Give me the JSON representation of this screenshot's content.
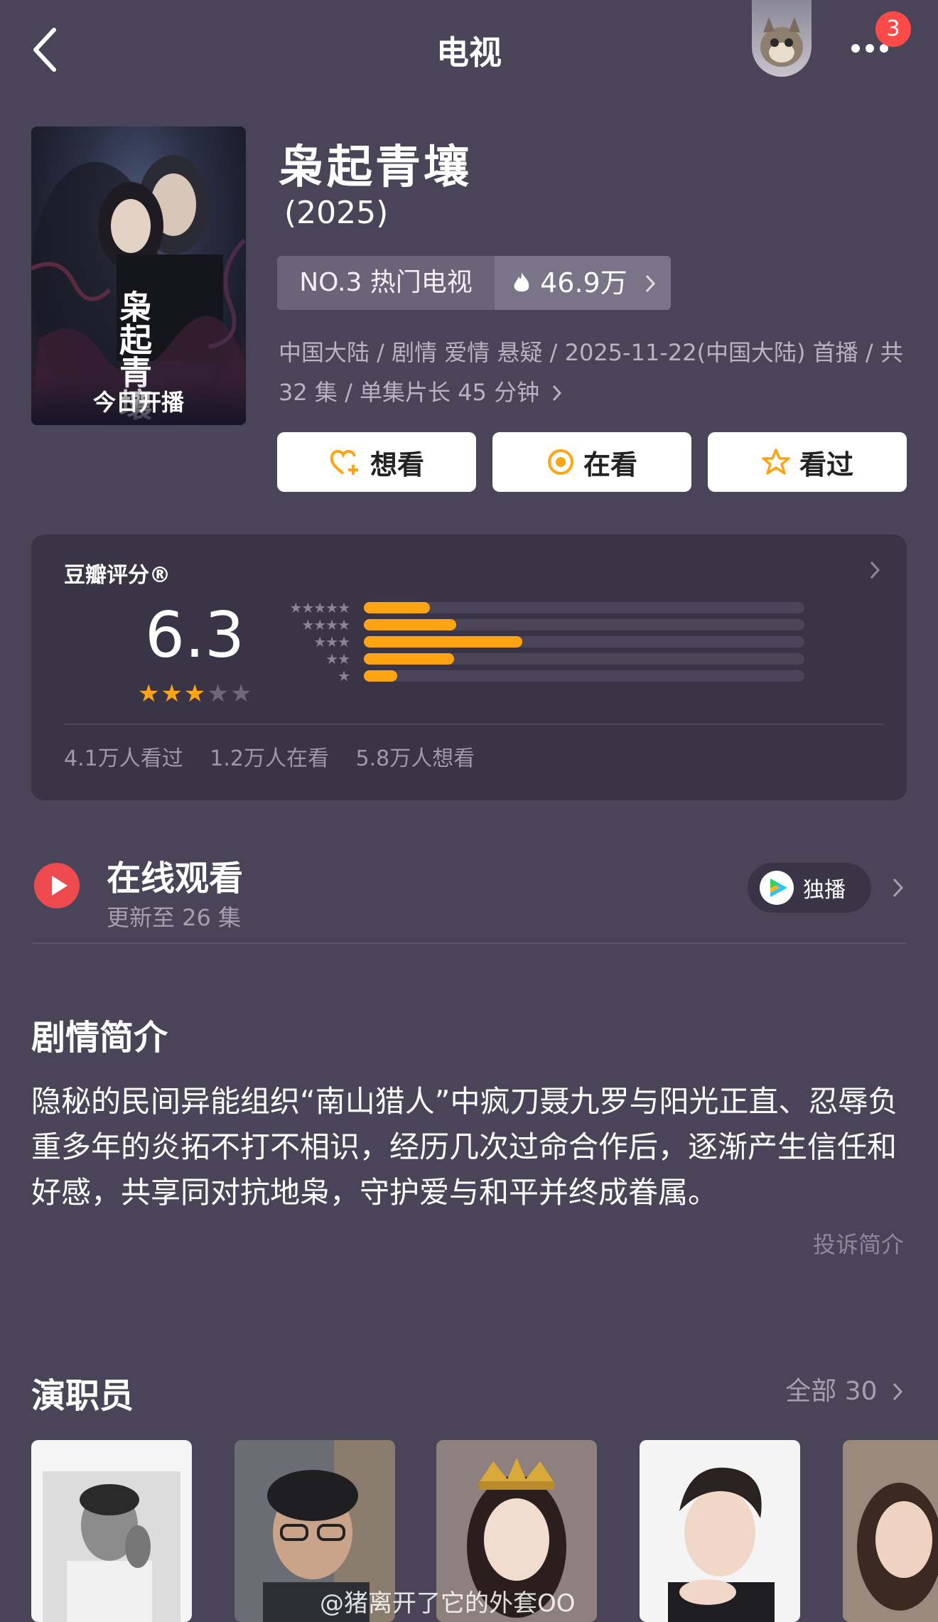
{
  "header": {
    "title": "电视",
    "back_icon": "chevron-left-icon",
    "more_icon": "more-dots-icon",
    "notification_count": "3"
  },
  "poster": {
    "banner_text": "今日开播",
    "logo_text": "枭起青壤"
  },
  "show": {
    "title": "枭起青壤",
    "year": "(2025)",
    "rank_label": "NO.3 热门电视",
    "heat_value": "46.9万",
    "meta": "中国大陆 / 剧情 爱情 悬疑 / 2025-11-22(中国大陆) 首播 / 共 32 集 / 单集片长 45 分钟"
  },
  "actions": {
    "want": "想看",
    "watching": "在看",
    "watched": "看过"
  },
  "rating": {
    "label": "豆瓣评分®",
    "score": "6.3",
    "stars_filled": 3,
    "stars_total": 5,
    "distribution": [
      {
        "stars": "★★★★★",
        "fraction": 0.15
      },
      {
        "stars": "★★★★",
        "fraction": 0.21
      },
      {
        "stars": "★★★",
        "fraction": 0.36
      },
      {
        "stars": "★★",
        "fraction": 0.205
      },
      {
        "stars": "★",
        "fraction": 0.075
      }
    ],
    "watched_count": "4.1万人看过",
    "watching_count": "1.2万人在看",
    "want_count": "5.8万人想看"
  },
  "online": {
    "title": "在线观看",
    "subtitle": "更新至 26 集",
    "exclusive_label": "独播"
  },
  "synopsis": {
    "title": "剧情简介",
    "text": "隐秘的民间异能组织“南山猎人”中疯刀聂九罗与阳光正直、忍辱负重多年的炎拓不打不相识，经历几次过命合作后，逐渐产生信任和好感，共享同对抗地枭，守护爱与和平并终成眷属。",
    "complain": "投诉简介"
  },
  "cast": {
    "title": "演职员",
    "all_label": "全部 30"
  },
  "watermark": "@猪离开了它的外套OO",
  "colors": {
    "background": "#4a4458",
    "accent_orange": "#ffa515",
    "play_red": "#ef4b4f",
    "badge_red": "#ff4a4a"
  }
}
